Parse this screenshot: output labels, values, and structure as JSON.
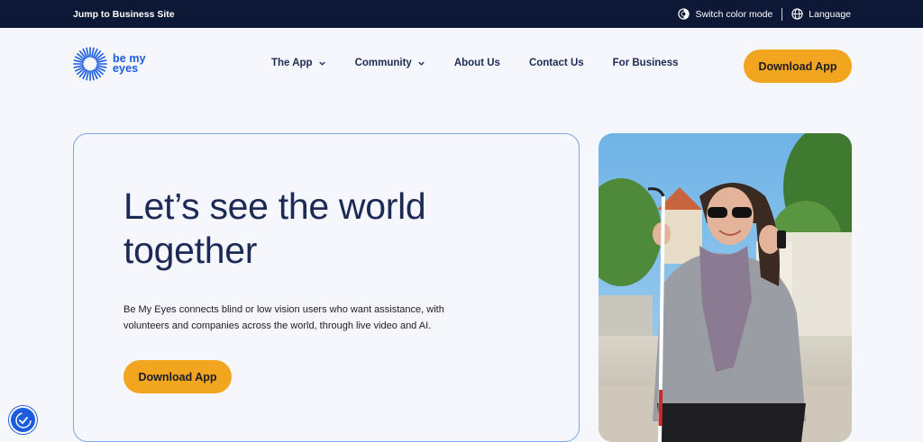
{
  "topbar": {
    "jump_label": "Jump to Business Site",
    "color_mode_label": "Switch color mode",
    "language_label": "Language"
  },
  "logo": {
    "line1": "be my",
    "line2": "eyes"
  },
  "nav": {
    "items": [
      {
        "label": "The App",
        "has_dropdown": true
      },
      {
        "label": "Community",
        "has_dropdown": true
      },
      {
        "label": "About Us",
        "has_dropdown": false
      },
      {
        "label": "Contact Us",
        "has_dropdown": false
      },
      {
        "label": "For Business",
        "has_dropdown": false
      }
    ],
    "download_label": "Download App"
  },
  "hero": {
    "title_line1": "Let’s see the world",
    "title_line2": "together",
    "description": "Be My Eyes connects blind or low vision users who want assistance, with volunteers and companies across the world, through live video and AI.",
    "download_label": "Download App"
  },
  "colors": {
    "topbar_bg": "#0c1836",
    "brand_blue": "#1b5be0",
    "accent_yellow": "#f2a51e",
    "text_navy": "#1c2a55",
    "page_bg": "#f5f7fd"
  },
  "icons": {
    "color_mode": "contrast-icon",
    "language": "globe-icon",
    "dropdown": "chevron-down-icon",
    "accessibility": "accessibility-check-icon"
  }
}
